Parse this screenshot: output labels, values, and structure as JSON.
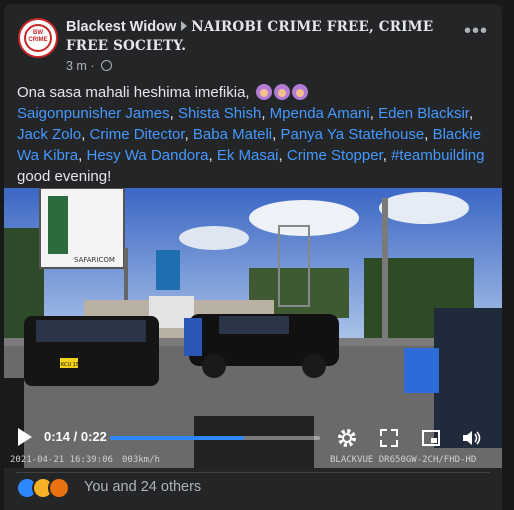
{
  "post": {
    "author": "Blackest Widow",
    "group": "NAIROBI CRIME FREE, CRIME FREE SOCIETY.",
    "time": "3 m",
    "time_sep": "·",
    "more_label": "•••",
    "avatar_text": "BLACKEST WIDOW CRIME",
    "text_line1": "Ona sasa mahali heshima imefikia,",
    "tags": [
      "Saigonpunisher James",
      "Shista Shish",
      "Mpenda Amani",
      "Eden Blacksir",
      "Jack Zolo",
      "Crime Ditector",
      "Baba Mateli",
      "Panya Ya Statehouse",
      "Blackie Wa Kibra",
      "Hesy Wa Dandora",
      "Ek Masai",
      "Crime Stopper",
      "#teambuilding"
    ],
    "closing": "good evening!"
  },
  "video": {
    "time_label": "0:14 / 0:22",
    "progress": 0.64,
    "stamp_date": "2021-04-21  16:39:06",
    "stamp_speed": "003km/h",
    "stamp_brand": "BLACKVUE  DR650GW-2CH/FHD-HD",
    "billboard_text": "SAFARICOM",
    "plate_text": "KCU 154A"
  },
  "reactions": {
    "summary": "You and 24 others",
    "colors": {
      "like": "#2d88ff",
      "haha": "#f7b125",
      "angry": "#e9710f"
    }
  }
}
